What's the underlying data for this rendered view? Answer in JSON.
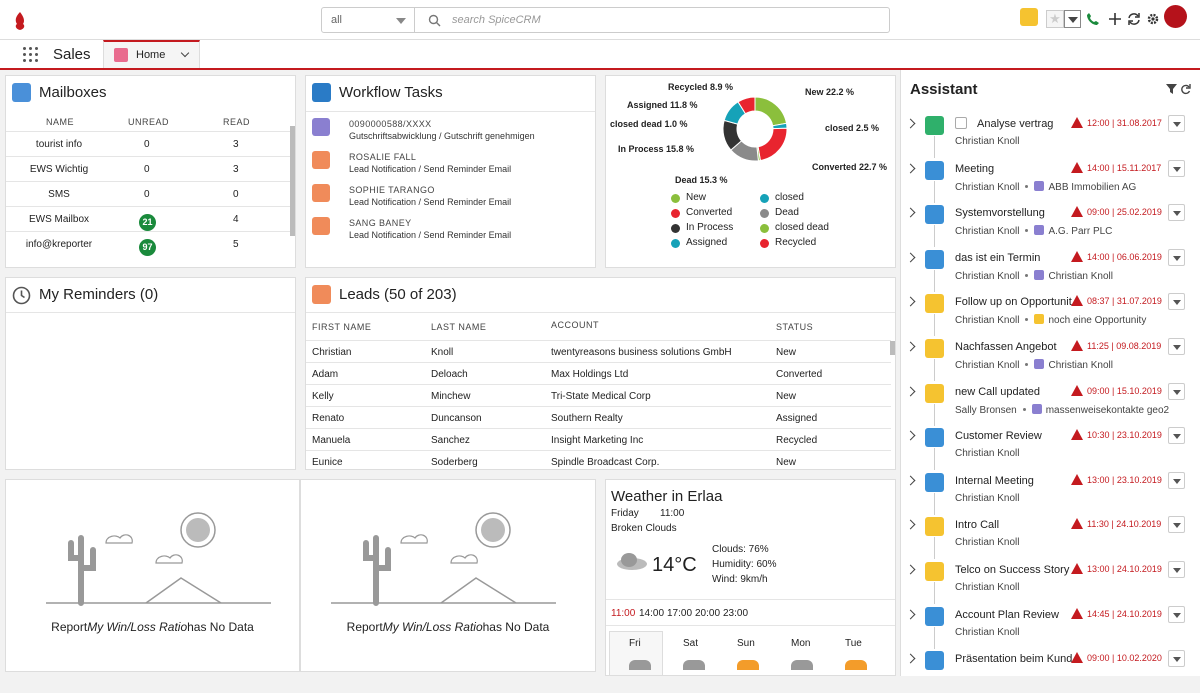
{
  "search": {
    "scope": "all",
    "placeholder": "search SpiceCRM"
  },
  "app": {
    "name": "Sales",
    "tab": "Home"
  },
  "mailboxes": {
    "title": "Mailboxes",
    "cols": [
      "NAME",
      "UNREAD",
      "READ"
    ],
    "rows": [
      {
        "name": "tourist info",
        "unread": "0",
        "read": "3"
      },
      {
        "name": "EWS Wichtig",
        "unread": "0",
        "read": "3"
      },
      {
        "name": "SMS",
        "unread": "0",
        "read": "0"
      },
      {
        "name": "EWS Mailbox",
        "unread": "21",
        "read": "4"
      },
      {
        "name": "info@kreporter",
        "unread": "97",
        "read": "5"
      }
    ]
  },
  "workflow": {
    "title": "Workflow Tasks",
    "items": [
      {
        "t": "0090000588/XXXX",
        "s": "Gutschriftsabwicklung / Gutschrift genehmigen"
      },
      {
        "t": "ROSALIE FALL",
        "s": "Lead Notification / Send Reminder Email"
      },
      {
        "t": "SOPHIE TARANGO",
        "s": "Lead Notification / Send Reminder Email"
      },
      {
        "t": "SANG BANEY",
        "s": "Lead Notification / Send Reminder Email"
      }
    ]
  },
  "chart_data": {
    "type": "pie",
    "categories": [
      "New",
      "Converted",
      "In Process",
      "Assigned",
      "closed",
      "Dead",
      "closed dead",
      "Recycled"
    ],
    "values": [
      22.2,
      22.7,
      15.8,
      11.8,
      2.5,
      15.3,
      1.0,
      8.9
    ],
    "labels": [
      "New 22.2 %",
      "Converted 22.7 %",
      "In Process 15.8 %",
      "Assigned 11.8 %",
      "closed 2.5 %",
      "Dead 15.3 %",
      "closed dead 1.0 %",
      "Recycled 8.9 %"
    ],
    "colors": [
      "#8bbf3c",
      "#e8242f",
      "#333333",
      "#16a2b8",
      "#16a2b8",
      "#8a8a8a",
      "#8bbf3c",
      "#e8242f"
    ],
    "legend": "bottom"
  },
  "reminders": {
    "title": "My Reminders (0)"
  },
  "leads": {
    "title": "Leads (50 of 203)",
    "cols": [
      "FIRST NAME",
      "LAST NAME",
      "ACCOUNT",
      "STATUS"
    ],
    "rows": [
      {
        "f": "Christian",
        "l": "Knoll",
        "a": "twentyreasons business solutions GmbH",
        "s": "New"
      },
      {
        "f": "Adam",
        "l": "Deloach",
        "a": "Max Holdings Ltd",
        "s": "Converted"
      },
      {
        "f": "Kelly",
        "l": "Minchew",
        "a": "Tri-State Medical Corp",
        "s": "New"
      },
      {
        "f": "Renato",
        "l": "Duncanson",
        "a": "Southern Realty",
        "s": "Assigned"
      },
      {
        "f": "Manuela",
        "l": "Sanchez",
        "a": "Insight Marketing Inc",
        "s": "Recycled"
      },
      {
        "f": "Eunice",
        "l": "Soderberg",
        "a": "Spindle Broadcast Corp.",
        "s": "New"
      }
    ]
  },
  "report1": {
    "pre": "Report",
    "name": "My Win/Loss Ratio",
    "post": "has No Data"
  },
  "report2": {
    "pre": "Report",
    "name": "My Win/Loss Ratio",
    "post": "has No Data"
  },
  "weather": {
    "title": "Weather in Erlaa",
    "day": "Friday",
    "time": "11:00",
    "desc": "Broken Clouds",
    "temp": "14°C",
    "clouds": "Clouds: 76%",
    "humidity": "Humidity: 60%",
    "wind": "Wind: 9km/h",
    "hours": [
      "11:00",
      "14:00",
      "17:00",
      "20:00",
      "23:00"
    ],
    "days": [
      "Fri",
      "Sat",
      "Sun",
      "Mon",
      "Tue"
    ]
  },
  "assistant": {
    "title": "Assistant",
    "items": [
      {
        "title": "Analyse vertrag",
        "date": "12:00 | 31.08.2017",
        "sub": "Christian Knoll",
        "rel": "",
        "type": "task"
      },
      {
        "title": "Meeting",
        "date": "14:00 | 15.11.2017",
        "sub": "Christian Knoll",
        "rel": "ABB Immobilien AG",
        "type": "meeting"
      },
      {
        "title": "Systemvorstellung",
        "date": "09:00 | 25.02.2019",
        "sub": "Christian Knoll",
        "rel": "A.G. Parr PLC",
        "type": "meeting"
      },
      {
        "title": "das ist ein Termin",
        "date": "14:00 | 06.06.2019",
        "sub": "Christian Knoll",
        "rel": "Christian Knoll",
        "type": "meeting"
      },
      {
        "title": "Follow up on Opportunit",
        "date": "08:37 | 31.07.2019",
        "sub": "Christian Knoll",
        "rel": "noch eine Opportunity",
        "type": "call"
      },
      {
        "title": "Nachfassen Angebot",
        "date": "11:25 | 09.08.2019",
        "sub": "Christian Knoll",
        "rel": "Christian Knoll",
        "type": "call"
      },
      {
        "title": "new Call updated",
        "date": "09:00 | 15.10.2019",
        "sub": "Sally Bronsen",
        "rel": "massenweisekontakte geo2",
        "type": "call"
      },
      {
        "title": "Customer Review",
        "date": "10:30 | 23.10.2019",
        "sub": "Christian Knoll",
        "rel": "",
        "type": "meeting"
      },
      {
        "title": "Internal Meeting",
        "date": "13:00 | 23.10.2019",
        "sub": "Christian Knoll",
        "rel": "",
        "type": "meeting"
      },
      {
        "title": "Intro Call",
        "date": "11:30 | 24.10.2019",
        "sub": "Christian Knoll",
        "rel": "",
        "type": "call"
      },
      {
        "title": "Telco on Success Story",
        "date": "13:00 | 24.10.2019",
        "sub": "Christian Knoll",
        "rel": "",
        "type": "call"
      },
      {
        "title": "Account Plan Review",
        "date": "14:45 | 24.10.2019",
        "sub": "Christian Knoll",
        "rel": "",
        "type": "meeting"
      },
      {
        "title": "Präsentation beim Kund",
        "date": "09:00 | 10.02.2020",
        "sub": "",
        "rel": "",
        "type": "meeting"
      }
    ]
  }
}
